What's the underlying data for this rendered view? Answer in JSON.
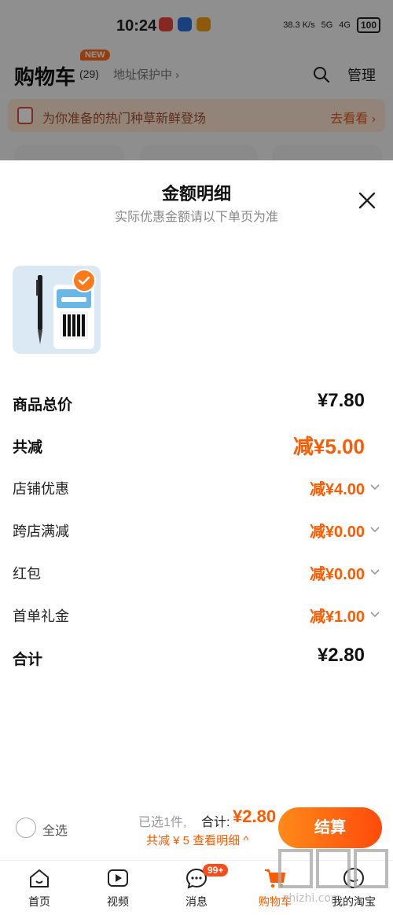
{
  "status_bar": {
    "time": "10:24",
    "network_speed": "38.3 K/s",
    "signal_1": "5G",
    "signal_2": "4G",
    "battery": "100"
  },
  "header": {
    "title": "购物车",
    "count": "(29)",
    "new_badge": "NEW",
    "address": "地址保护中 ›",
    "manage": "管理"
  },
  "banner": {
    "text": "为你准备的热门种草新鲜登场",
    "link": "去看看 ›"
  },
  "sheet": {
    "title": "金额明细",
    "subtitle": "实际优惠金额请以下单页为准",
    "rows": [
      {
        "label": "商品总价",
        "value": "¥7.80"
      },
      {
        "label": "共减",
        "value": "减¥5.00"
      },
      {
        "label": "店铺优惠",
        "value": "减¥4.00"
      },
      {
        "label": "跨店满减",
        "value": "减¥0.00"
      },
      {
        "label": "红包",
        "value": "减¥0.00"
      },
      {
        "label": "首单礼金",
        "value": "减¥1.00"
      },
      {
        "label": "合计",
        "value": "¥2.80"
      }
    ]
  },
  "checkout": {
    "select_all": "全选",
    "selected_info": "已选1件,",
    "total_label": "合计:",
    "total_value": "¥2.80",
    "discount_link": "共减 ¥ 5  查看明细 ^",
    "pay_button": "结算"
  },
  "tabbar": {
    "items": [
      {
        "label": "首页",
        "icon": "home-icon"
      },
      {
        "label": "视频",
        "icon": "video-icon"
      },
      {
        "label": "消息",
        "icon": "message-icon",
        "badge": "99+"
      },
      {
        "label": "购物车",
        "icon": "cart-icon"
      },
      {
        "label": "我的淘宝",
        "icon": "profile-icon"
      }
    ]
  },
  "watermark": "zhizhi.com",
  "colors": {
    "accent": "#ff5a00",
    "brand_orange": "#ff7a1a"
  }
}
